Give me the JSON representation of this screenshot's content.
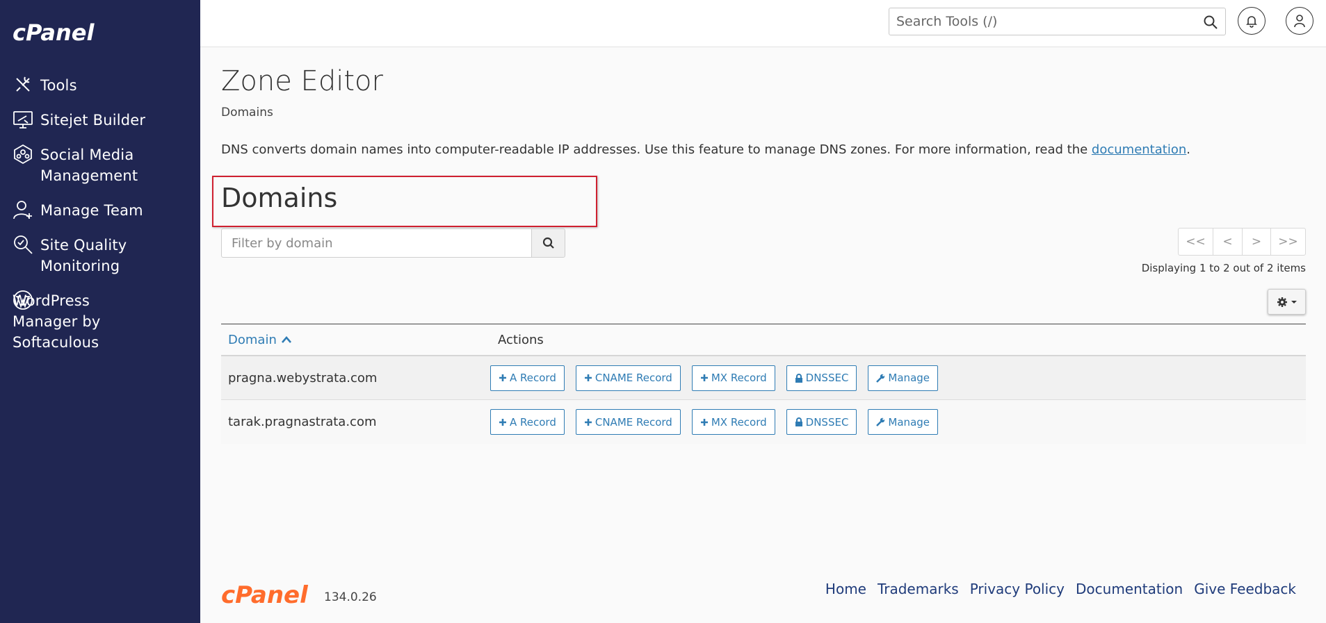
{
  "sidebar": {
    "brand": "cPanel",
    "items": [
      {
        "label": "Tools",
        "icon": "tools-icon"
      },
      {
        "label": "Sitejet Builder",
        "icon": "sitejet-icon"
      },
      {
        "label": "Social Media\nManagement",
        "icon": "social-media-icon"
      },
      {
        "label": "Manage Team",
        "icon": "manage-team-icon"
      },
      {
        "label": "Site Quality\nMonitoring",
        "icon": "site-quality-icon"
      },
      {
        "label": "WordPress\nManager by\nSoftaculous",
        "icon": "wordpress-icon"
      }
    ]
  },
  "header": {
    "search_placeholder": "Search Tools (/)"
  },
  "main": {
    "title": "Zone Editor",
    "breadcrumb": "Domains",
    "description_prefix": "DNS converts domain names into computer-readable IP addresses. Use this feature to manage DNS zones. For more information, read the ",
    "description_link": "documentation",
    "description_suffix": ".",
    "section_title": "Domains",
    "filter_placeholder": "Filter by domain",
    "pager": {
      "first": "<<",
      "prev": "<",
      "next": ">",
      "last": ">>"
    },
    "display_info": "Displaying 1 to 2 out of 2 items",
    "table": {
      "col_domain": "Domain",
      "col_actions": "Actions",
      "action_labels": {
        "a": "A Record",
        "cname": "CNAME Record",
        "mx": "MX Record",
        "dnssec": "DNSSEC",
        "manage": "Manage"
      },
      "rows": [
        {
          "domain": "pragna.webystrata.com"
        },
        {
          "domain": "tarak.pragnastrata.com"
        }
      ]
    }
  },
  "footer": {
    "version": "134.0.26",
    "links": [
      "Home",
      "Trademarks",
      "Privacy Policy",
      "Documentation",
      "Give Feedback"
    ]
  },
  "colors": {
    "sidebar": "#202652",
    "accent": "#2f7cb4",
    "footer_logo": "#ff6c2c",
    "highlight": "#cf2030"
  }
}
